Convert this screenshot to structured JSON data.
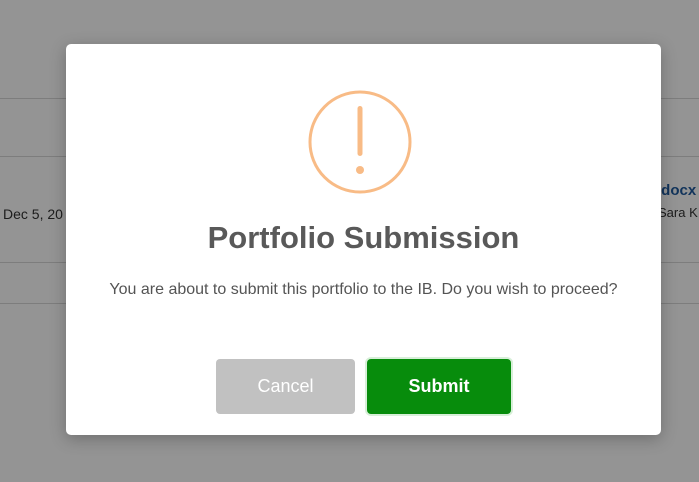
{
  "background": {
    "date_partial": "Dec 5, 20",
    "file_name_partial": ".docx",
    "file_owner_partial": "Sara K"
  },
  "modal": {
    "icon": "exclamation-circle-icon",
    "icon_color": "#f8bb86",
    "title": "Portfolio Submission",
    "message": "You are about to submit this portfolio to the IB. Do you wish to proceed?",
    "cancel_label": "Cancel",
    "submit_label": "Submit",
    "submit_color": "#078c0c",
    "cancel_color": "#c1c1c1"
  }
}
